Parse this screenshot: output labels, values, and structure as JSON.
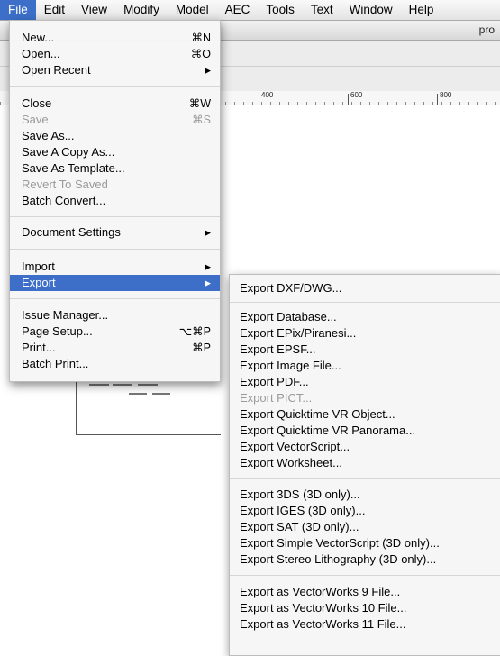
{
  "menubar": {
    "items": [
      {
        "label": "File",
        "active": true
      },
      {
        "label": "Edit"
      },
      {
        "label": "View"
      },
      {
        "label": "Modify"
      },
      {
        "label": "Model"
      },
      {
        "label": "AEC"
      },
      {
        "label": "Tools"
      },
      {
        "label": "Text"
      },
      {
        "label": "Window"
      },
      {
        "label": "Help"
      }
    ]
  },
  "document": {
    "title_fragment": "pro",
    "ruler_labels": [
      "400",
      "600",
      "800"
    ]
  },
  "file_menu": {
    "items": [
      {
        "label": "New...",
        "shortcut": "⌘N"
      },
      {
        "label": "Open...",
        "shortcut": "⌘O"
      },
      {
        "label": "Open Recent",
        "submenu": true
      },
      {
        "label": "Close",
        "shortcut": "⌘W"
      },
      {
        "label": "Save",
        "shortcut": "⌘S",
        "disabled": true
      },
      {
        "label": "Save As..."
      },
      {
        "label": "Save A Copy As..."
      },
      {
        "label": "Save As Template..."
      },
      {
        "label": "Revert To Saved",
        "disabled": true
      },
      {
        "label": "Batch Convert..."
      },
      {
        "label": "Document Settings",
        "submenu": true
      },
      {
        "label": "Import",
        "submenu": true
      },
      {
        "label": "Export",
        "submenu": true,
        "highlighted": true
      },
      {
        "label": "Issue Manager..."
      },
      {
        "label": "Page Setup...",
        "shortcut": "⌥⌘P"
      },
      {
        "label": "Print...",
        "shortcut": "⌘P"
      },
      {
        "label": "Batch Print..."
      }
    ],
    "submenu_arrow": "▶"
  },
  "export_menu": {
    "items": [
      {
        "label": "Export DXF/DWG..."
      },
      {
        "label": "Export Database..."
      },
      {
        "label": "Export EPix/Piranesi..."
      },
      {
        "label": "Export EPSF..."
      },
      {
        "label": "Export Image File..."
      },
      {
        "label": "Export PDF..."
      },
      {
        "label": "Export PICT...",
        "disabled": true
      },
      {
        "label": "Export Quicktime VR Object..."
      },
      {
        "label": "Export Quicktime VR Panorama..."
      },
      {
        "label": "Export VectorScript..."
      },
      {
        "label": "Export Worksheet..."
      },
      {
        "label": "Export 3DS (3D only)..."
      },
      {
        "label": "Export IGES (3D only)..."
      },
      {
        "label": "Export SAT (3D only)..."
      },
      {
        "label": "Export Simple VectorScript (3D only)..."
      },
      {
        "label": "Export Stereo Lithography (3D only)..."
      },
      {
        "label": "Export as VectorWorks 9 File..."
      },
      {
        "label": "Export as VectorWorks 10 File..."
      },
      {
        "label": "Export as VectorWorks 11 File..."
      }
    ]
  },
  "colors": {
    "highlight": "#3d6fc9",
    "disabled_text": "#9a9a9a",
    "menu_bg": "#f6f6f6"
  }
}
